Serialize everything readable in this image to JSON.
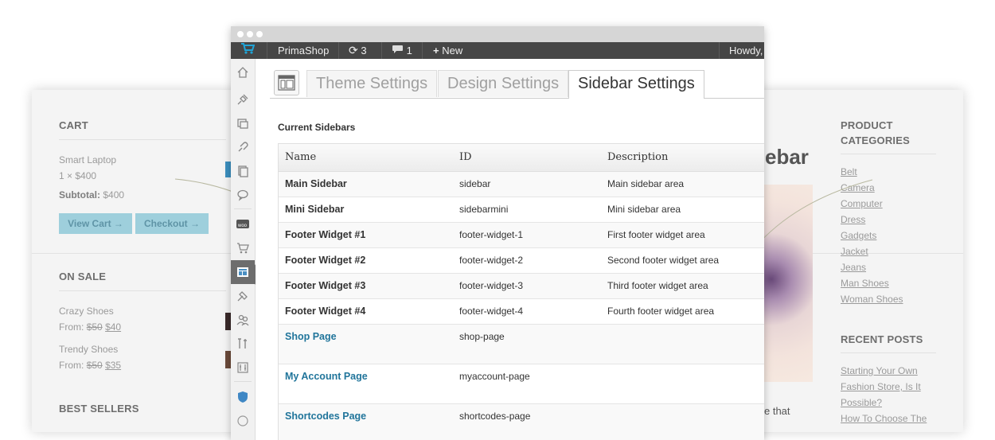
{
  "storefront": {
    "cart": {
      "heading": "CART",
      "item": "Smart Laptop",
      "qty_price": "1 × $400",
      "subtotal_label": "Subtotal:",
      "subtotal_value": "$400",
      "view_cart": "View Cart →",
      "checkout": "Checkout →"
    },
    "on_sale": {
      "heading": "ON SALE",
      "items": [
        {
          "name": "Crazy Shoes",
          "from": "From:",
          "old": "$50",
          "new": "$40"
        },
        {
          "name": "Trendy Shoes",
          "from": "From:",
          "old": "$50",
          "new": "$35"
        }
      ]
    },
    "best_sellers": {
      "heading": "BEST SELLERS"
    },
    "categories": {
      "heading_line1": "PRODUCT",
      "heading_line2": "CATEGORIES",
      "items": [
        "Belt",
        "Camera",
        "Computer",
        "Dress",
        "Gadgets",
        "Jacket",
        "Jeans",
        "Man Shoes",
        "Woman Shoes"
      ]
    },
    "recent_posts": {
      "heading": "RECENT POSTS",
      "items": [
        "Starting Your Own",
        "Fashion Store, Is It",
        "Possible?",
        "How To Choose The"
      ]
    },
    "peek": {
      "title_fragment": "ebar",
      "text_fragment": "e that"
    }
  },
  "admin_bar": {
    "site_name": "PrimaShop",
    "updates_count": "3",
    "comments_count": "1",
    "new_label": "New",
    "howdy": "Howdy,"
  },
  "tabs": [
    {
      "label": "Theme Settings",
      "active": false
    },
    {
      "label": "Design Settings",
      "active": false
    },
    {
      "label": "Sidebar Settings",
      "active": true
    }
  ],
  "section_title": "Current Sidebars",
  "table": {
    "headers": [
      "Name",
      "ID",
      "Description"
    ],
    "rows": [
      {
        "name": "Main Sidebar",
        "id": "sidebar",
        "description": "Main sidebar area"
      },
      {
        "name": "Mini Sidebar",
        "id": "sidebarmini",
        "description": "Mini sidebar area"
      },
      {
        "name": "Footer Widget #1",
        "id": "footer-widget-1",
        "description": "First footer widget area"
      },
      {
        "name": "Footer Widget #2",
        "id": "footer-widget-2",
        "description": "Second footer widget area"
      },
      {
        "name": "Footer Widget #3",
        "id": "footer-widget-3",
        "description": "Third footer widget area"
      },
      {
        "name": "Footer Widget #4",
        "id": "footer-widget-4",
        "description": "Fourth footer widget area"
      },
      {
        "name": "Shop Page",
        "id": "shop-page",
        "description": ""
      },
      {
        "name": "My Account Page",
        "id": "myaccount-page",
        "description": ""
      },
      {
        "name": "Shortcodes Page",
        "id": "shortcodes-page",
        "description": ""
      }
    ]
  },
  "menu_icons": [
    "home-icon",
    "pin-icon",
    "media-icon",
    "links-icon",
    "pages-icon",
    "comments-icon",
    "woo-icon",
    "cart-icon",
    "theme-settings-icon",
    "appearance-icon",
    "users-icon",
    "tools-icon",
    "settings-icon",
    "shield-icon"
  ],
  "colors": {
    "admin_bar": "#464646",
    "link": "#21759b",
    "button_bg": "#9ecfdc"
  }
}
